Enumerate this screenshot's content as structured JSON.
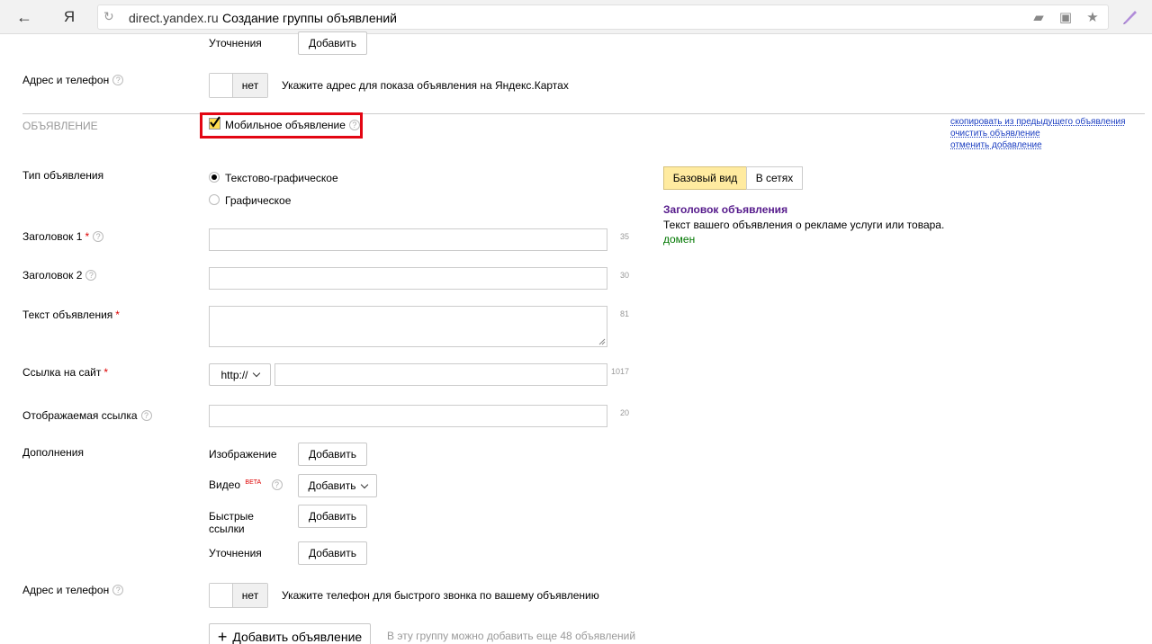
{
  "browser": {
    "back_icon": "←",
    "yandex_logo": "Я",
    "domain": "direct.yandex.ru",
    "page_title": "Создание группы объявлений"
  },
  "top_section": {
    "refinements_label": "Уточнения",
    "refinements_button": "Добавить",
    "address_label": "Адрес и телефон",
    "address_toggle": "нет",
    "address_hint": "Укажите адрес для показа объявления на Яндекс.Картах"
  },
  "ad_section": {
    "section_title": "ОБЪЯВЛЕНИЕ",
    "mobile_ad_label": "Мобильное объявление",
    "mobile_ad_checked": true,
    "links": {
      "copy": "скопировать из предыдущего объявления",
      "clear": "очистить объявление",
      "cancel": "отменить добавление"
    },
    "ad_type_label": "Тип объявления",
    "ad_type_options": [
      "Текстово-графическое",
      "Графическое"
    ],
    "ad_type_selected": 0,
    "title1_label": "Заголовок 1",
    "title1_counter": "35",
    "title2_label": "Заголовок 2",
    "title2_counter": "30",
    "text_label": "Текст объявления",
    "text_counter": "81",
    "url_label": "Ссылка на сайт",
    "url_protocol": "http://",
    "url_counter": "1017",
    "display_url_label": "Отображаемая ссылка",
    "display_url_counter": "20",
    "extras_label": "Дополнения",
    "image_label": "Изображение",
    "image_button": "Добавить",
    "video_label": "Видео",
    "video_beta": "BETA",
    "video_button": "Добавить",
    "quicklinks_label_1": "Быстрые",
    "quicklinks_label_2": "ссылки",
    "quicklinks_button": "Добавить",
    "refinements_label": "Уточнения",
    "refinements_button": "Добавить",
    "address_label": "Адрес и телефон",
    "address_toggle": "нет",
    "address_hint": "Укажите телефон для быстрого звонка по вашему объявлению",
    "add_ad_button": "Добавить объявление",
    "add_ad_hint": "В эту группу можно добавить еще 48 объявлений"
  },
  "preview": {
    "tabs": [
      "Базовый вид",
      "В сетях"
    ],
    "active_tab": 0,
    "headline": "Заголовок объявления",
    "text": "Текст вашего объявления о рекламе услуги или товара.",
    "domain": "домен"
  },
  "colors": {
    "highlight_border": "#e30613",
    "preview_headline": "#551a8b",
    "preview_domain": "#007700",
    "active_tab": "#ffeba0"
  }
}
